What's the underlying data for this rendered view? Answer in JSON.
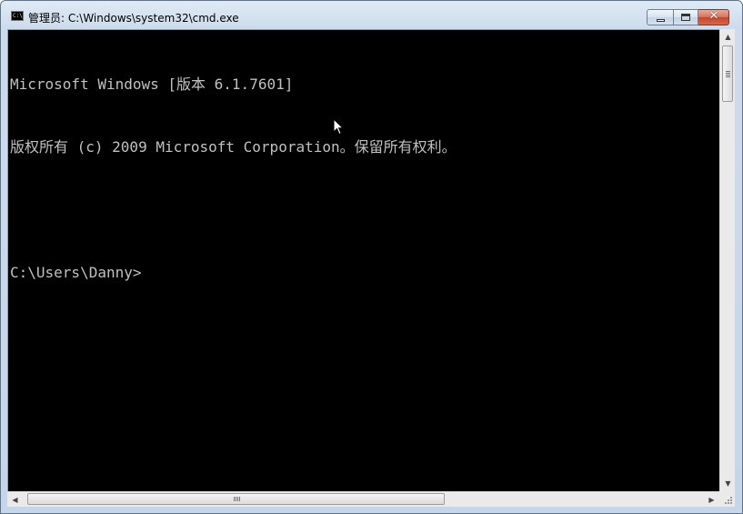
{
  "window": {
    "title": "管理员: C:\\Windows\\system32\\cmd.exe",
    "icon": "cmd-icon",
    "icon_text": "C:\\",
    "controls": {
      "minimize": "minimize-icon",
      "maximize": "maximize-icon",
      "close": "close-icon",
      "close_glyph": "✕"
    }
  },
  "console": {
    "lines": [
      "Microsoft Windows [版本 6.1.7601]",
      "版权所有 (c) 2009 Microsoft Corporation。保留所有权利。",
      "",
      "C:\\Users\\Danny>"
    ],
    "text_color": "#c0c0c0",
    "background_color": "#000000"
  },
  "scrollbars": {
    "vertical": {
      "up": "▲",
      "down": "▼"
    },
    "horizontal": {
      "left": "◀",
      "right": "▶"
    }
  }
}
